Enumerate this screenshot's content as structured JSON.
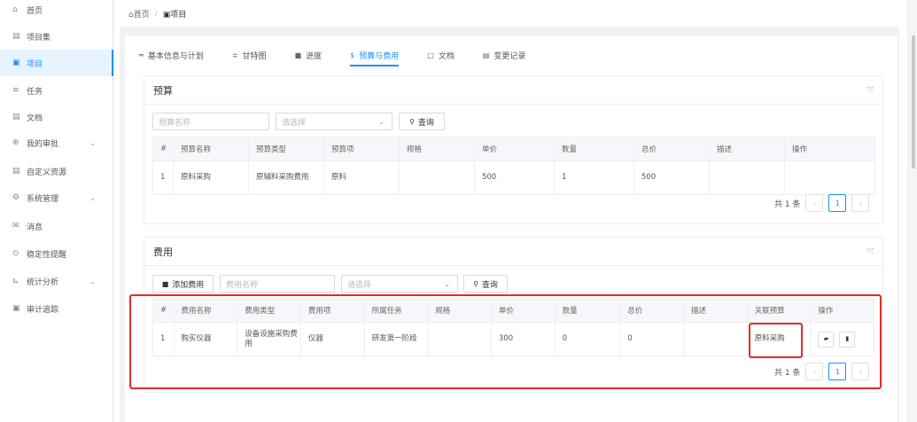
{
  "sidebar": {
    "items": [
      {
        "icon": "⌂",
        "label": "首页",
        "chevron": ""
      },
      {
        "icon": "▤",
        "label": "项目集",
        "chevron": ""
      },
      {
        "icon": "▣",
        "label": "项目",
        "chevron": ""
      },
      {
        "icon": "≡",
        "label": "任务",
        "chevron": ""
      },
      {
        "icon": "▤",
        "label": "文档",
        "chevron": ""
      },
      {
        "icon": "⊕",
        "label": "我的审批",
        "chevron": "⌄"
      },
      {
        "icon": "▤",
        "label": "自定义资源",
        "chevron": ""
      },
      {
        "icon": "⚙",
        "label": "系统管理",
        "chevron": "⌄"
      },
      {
        "icon": "✉",
        "label": "消息",
        "chevron": ""
      },
      {
        "icon": "⊙",
        "label": "稳定性提醒",
        "chevron": ""
      },
      {
        "icon": "⊾",
        "label": "统计分析",
        "chevron": "⌄"
      },
      {
        "icon": "▣",
        "label": "审计追踪",
        "chevron": ""
      }
    ]
  },
  "breadcrumb": {
    "home": "⌂首页",
    "sep": "/",
    "current": "▣项目"
  },
  "tabs": [
    {
      "icon": "═",
      "label": "基本信息与计划"
    },
    {
      "icon": "≑",
      "label": "甘特图"
    },
    {
      "icon": "■",
      "label": "进度"
    },
    {
      "icon": "$",
      "label": "预算与费用"
    },
    {
      "icon": "□",
      "label": "文档"
    },
    {
      "icon": "▤",
      "label": "变更记录"
    }
  ],
  "budget": {
    "title": "预算",
    "collapse_icon": "⤧",
    "name_placeholder": "预算名称",
    "select_placeholder": "请选择",
    "select_chev": "⌄",
    "query_icon": "⚲",
    "query_label": "查询",
    "columns": [
      "#",
      "预算名称",
      "预算类型",
      "预算项",
      "规格",
      "单价",
      "数量",
      "总价",
      "描述",
      "操作"
    ],
    "rows": [
      [
        "1",
        "原料采购",
        "原辅料采购费用",
        "原料",
        "",
        "500",
        "1",
        "500",
        "",
        ""
      ]
    ],
    "total": "共 1 条",
    "prev": "‹",
    "page": "1",
    "next": "›"
  },
  "expense": {
    "title": "费用",
    "collapse_icon": "⤧",
    "add_icon": "■",
    "add_label": "添加费用",
    "name_placeholder": "费用名称",
    "select_placeholder": "请选择",
    "select_chev": "⌄",
    "query_icon": "⚲",
    "query_label": "查询",
    "columns": [
      "#",
      "费用名称",
      "费用类型",
      "费用项",
      "所属任务",
      "规格",
      "单价",
      "数量",
      "总价",
      "描述",
      "关联预算",
      "操作"
    ],
    "rows": [
      [
        "1",
        "购买仪器",
        "设备设施采购费用",
        "仪器",
        "研发第一阶段",
        "",
        "300",
        "0",
        "0",
        "",
        "原料采购",
        ""
      ]
    ],
    "edit_icon": "▰",
    "delete_icon": "▮",
    "total": "共 1 条",
    "prev": "‹",
    "page": "1",
    "next": "›"
  },
  "colors": {
    "accent": "#1890ff",
    "highlight": "#e52b2b"
  }
}
